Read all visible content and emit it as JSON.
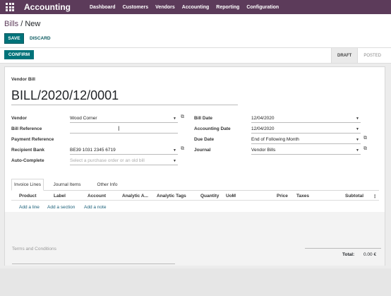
{
  "app": {
    "brand": "Accounting",
    "menu": [
      "Dashboard",
      "Customers",
      "Vendors",
      "Accounting",
      "Reporting",
      "Configuration"
    ]
  },
  "breadcrumb": {
    "parent": "Bills",
    "sep": " / ",
    "current": "New"
  },
  "toolbar": {
    "save": "SAVE",
    "discard": "DISCARD"
  },
  "statusbar": {
    "confirm": "CONFIRM",
    "steps": [
      "DRAFT",
      "POSTED"
    ],
    "active_step": "DRAFT"
  },
  "form": {
    "title_label": "Vendor Bill",
    "name": "BILL/2020/12/0001",
    "left": {
      "vendor_label": "Vendor",
      "vendor_value": "Wood Corner",
      "bill_ref_label": "Bill Reference",
      "bill_ref_value": "",
      "payment_ref_label": "Payment Reference",
      "payment_ref_value": "",
      "bank_label": "Recipient Bank",
      "bank_value": "BE39 1031 2345 6719",
      "autocomplete_label": "Auto-Complete",
      "autocomplete_placeholder": "Select a purchase order or an old bill"
    },
    "right": {
      "bill_date_label": "Bill Date",
      "bill_date_value": "12/04/2020",
      "acct_date_label": "Accounting Date",
      "acct_date_value": "12/04/2020",
      "due_date_label": "Due Date",
      "due_date_value": "End of Following Month",
      "journal_label": "Journal",
      "journal_value": "Vendor Bills"
    }
  },
  "tabs": [
    "Invoice Lines",
    "Journal Items",
    "Other Info"
  ],
  "active_tab": "Invoice Lines",
  "columns": [
    "Product",
    "Label",
    "Account",
    "Analytic A...",
    "Analytic Tags",
    "Quantity",
    "UoM",
    "Price",
    "Taxes",
    "Subtotal"
  ],
  "line_actions": [
    "Add a line",
    "Add a section",
    "Add a note"
  ],
  "footer": {
    "terms_placeholder": "Terms and Conditions",
    "total_label": "Total:",
    "total_value": "0.00 €"
  },
  "colors": {
    "topbar": "#5c3b5a",
    "primary": "#00737a"
  }
}
